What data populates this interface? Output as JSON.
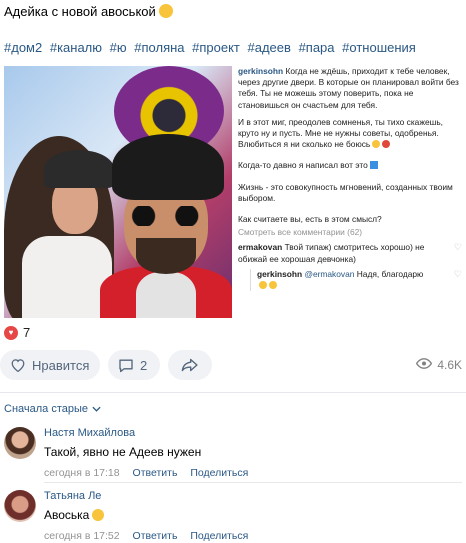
{
  "post": {
    "title": "Адейка с новой авоськой",
    "hashtags": [
      "#дом2",
      "#каналю",
      "#ю",
      "#поляна",
      "#проект",
      "#адеев",
      "#пара",
      "#отношения"
    ]
  },
  "screenshot_caption": {
    "author": "gerkinsohn",
    "paragraph1": "Когда не ждёшь, приходит к тебе человек, через другие двери. В которые он планировал войти без тебя. Ты не можешь этому поверить, пока не становишься он счастьем для тебя.",
    "paragraph2": "И в этот миг, преодолев сомненья, ты тихо скажешь, круто ну и пусть. Мне не нужны советы, одобренья. Влюбиться я ни сколько не боюсь",
    "paragraph3": "Когда-то давно я написал вот это",
    "paragraph4": "Жизнь - это совокупность мгновений, созданных твоим выбором.",
    "question": "Как считаете вы, есть в этом смысл?",
    "comments_link": "Смотреть все комментарии (62)",
    "comment1_author": "ermakovan",
    "comment1_text": "Твой типаж) смотритесь хорошо) не обижай ее хорошая девчонка)",
    "reply_author": "gerkinsohn",
    "reply_mention": "@ermakovan",
    "reply_text": "Надя, благодарю"
  },
  "likes": {
    "count": "7",
    "like_label": "Нравится",
    "comments_count": "2",
    "views": "4.6K"
  },
  "sort": {
    "label": "Сначала старые"
  },
  "comments": [
    {
      "name": "Настя Михайлова",
      "text": "Такой, явно не Адеев нужен",
      "time": "сегодня в 17:18",
      "reply": "Ответить",
      "share": "Поделиться"
    },
    {
      "name": "Татьяна Ле",
      "text": "Авоська",
      "time": "сегодня в 17:52",
      "reply": "Ответить",
      "share": "Поделиться"
    }
  ],
  "colors": {
    "link": "#2a5885",
    "like_red": "#e64646",
    "button_bg": "#f0f2f5"
  }
}
